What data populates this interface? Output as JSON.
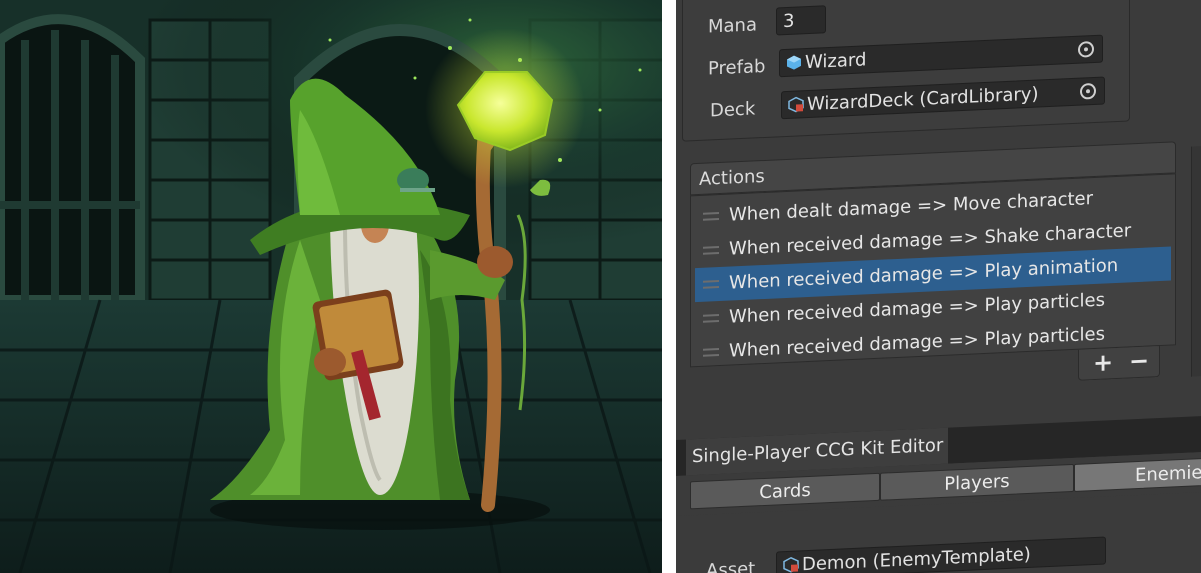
{
  "inspector": {
    "mana_label": "Mana",
    "mana_value": "3",
    "prefab_label": "Prefab",
    "prefab_value": "Wizard",
    "deck_label": "Deck",
    "deck_value": "WizardDeck (CardLibrary)"
  },
  "actions": {
    "header": "Actions",
    "items": [
      {
        "label": "When dealt damage => Move character",
        "selected": false
      },
      {
        "label": "When received damage => Shake character",
        "selected": false
      },
      {
        "label": "When received damage => Play animation",
        "selected": true
      },
      {
        "label": "When received damage => Play particles",
        "selected": false
      },
      {
        "label": "When received damage => Play particles",
        "selected": false
      }
    ],
    "add_label": "+",
    "remove_label": "−"
  },
  "editor_window": {
    "title": "Single-Player CCG Kit Editor",
    "tabs": [
      "Cards",
      "Players",
      "Enemies"
    ],
    "asset_label": "Asset",
    "asset_value": "Demon (EnemyTemplate)"
  },
  "colors": {
    "panel_bg": "#3b3b3b",
    "selection": "#2d5f8f",
    "orb_glow": "#d8f03a",
    "robe_green": "#5a9a2e"
  },
  "icons": [
    "prefab-cube-icon",
    "scriptable-object-icon",
    "object-picker-icon",
    "drag-handle-icon",
    "add-icon",
    "remove-icon"
  ]
}
